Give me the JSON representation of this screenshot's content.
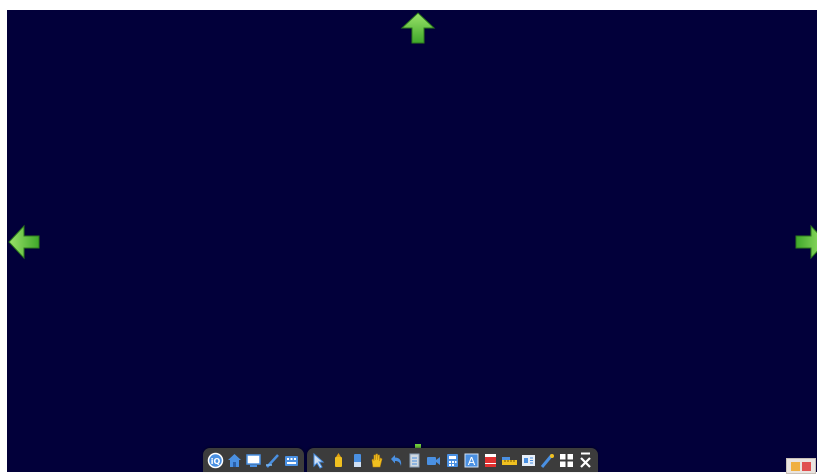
{
  "stage": {
    "background_color": "#02003a"
  },
  "arrows": {
    "color": "#6fcf3a",
    "up": "arrow-up-icon",
    "left": "arrow-left-icon",
    "right": "arrow-right-icon",
    "down": "arrow-down-icon"
  },
  "toolbar": {
    "background_color": "#3c3c3c",
    "left_group": [
      {
        "name": "info-icon",
        "color": "#4a90e2"
      },
      {
        "name": "home-icon",
        "color": "#4a90e2"
      },
      {
        "name": "whiteboard-icon",
        "color": "#4a90e2"
      },
      {
        "name": "pen-brush-icon",
        "color": "#4a90e2"
      },
      {
        "name": "keyboard-icon",
        "color": "#4a90e2"
      }
    ],
    "right_group": [
      {
        "name": "pointer-icon",
        "color": "#4a90e2"
      },
      {
        "name": "highlighter-icon",
        "color": "#f0c020"
      },
      {
        "name": "marker-icon",
        "color": "#4a90e2"
      },
      {
        "name": "hand-icon",
        "color": "#f0c020"
      },
      {
        "name": "undo-icon",
        "color": "#4a90e2"
      },
      {
        "name": "document-icon",
        "color": "#cfd8e0"
      },
      {
        "name": "video-camera-icon",
        "color": "#4a90e2"
      },
      {
        "name": "calculator-icon",
        "color": "#4a90e2"
      },
      {
        "name": "text-box-icon",
        "color": "#4a90e2"
      },
      {
        "name": "pdf-icon",
        "color": "#e03030"
      },
      {
        "name": "ruler-icon",
        "color": "#f0c020"
      },
      {
        "name": "speaker-icon",
        "color": "#4a90e2"
      },
      {
        "name": "eraser-pen-icon",
        "color": "#4a90e2"
      },
      {
        "name": "grid-icon",
        "color": "#ffffff"
      },
      {
        "name": "close-icon",
        "color": "#ffffff"
      }
    ]
  },
  "corner_widget": {
    "name": "color-swatch-icon",
    "colors": [
      "#f0b040",
      "#e05050"
    ]
  }
}
